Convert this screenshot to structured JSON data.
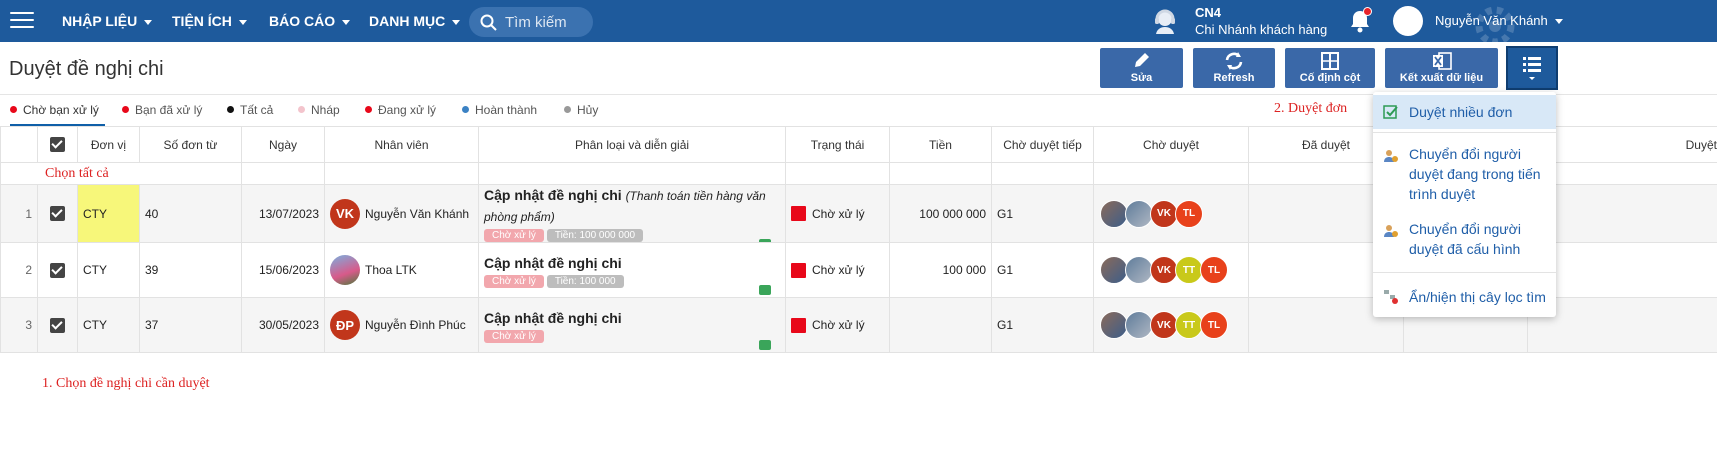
{
  "nav": {
    "items": [
      "NHẬP LIỆU",
      "TIỆN ÍCH",
      "BÁO CÁO",
      "DANH MỤC"
    ],
    "search_placeholder": "Tìm kiếm",
    "branch_code": "CN4",
    "branch_name": "Chi Nhánh khách hàng",
    "user_name": "Nguyễn Văn Khánh",
    "color": "#1e5a9c"
  },
  "page": {
    "title": "Duyệt đề nghị chi"
  },
  "toolbar": {
    "edit": "Sửa",
    "refresh": "Refresh",
    "fix_columns": "Cố định cột",
    "export": "Kết xuất dữ liệu"
  },
  "tabs": [
    {
      "label": "Chờ bạn xử lý",
      "color": "#e8081a"
    },
    {
      "label": "Bạn đã xử lý",
      "color": "#e8081a"
    },
    {
      "label": "Tất cả",
      "color": "#111111"
    },
    {
      "label": "Nháp",
      "color": "#f3c4cc"
    },
    {
      "label": "Đang xử lý",
      "color": "#e8081a"
    },
    {
      "label": "Hoàn thành",
      "color": "#3b82c4"
    },
    {
      "label": "Hủy",
      "color": "#999999"
    }
  ],
  "annotations": {
    "approve_hint": "2. Duyệt đơn",
    "select_all_hint": "Chọn tất cả",
    "select_rows_hint": "1. Chọn đề nghị chi cần duyệt"
  },
  "table": {
    "headers": [
      "Đơn vị",
      "Số đơn từ",
      "Ngày",
      "Nhân viên",
      "Phân loại và diễn giải",
      "Trạng thái",
      "Tiền",
      "Chờ duyệt tiếp",
      "Chờ duyệt",
      "Đã duyệt",
      "Duyệt"
    ],
    "rows": [
      {
        "num": "1",
        "unit": "CTY",
        "doc_no": "40",
        "date": "13/07/2023",
        "employee": "Nguyễn Văn Khánh",
        "employee_initials": "VK",
        "title": "Cập nhật đề nghị chi",
        "detail": "(Thanh toán tiền hàng văn phòng phẩm)",
        "tag_status": "Chờ xử lý",
        "tag_amount": "Tiền: 100 000 000",
        "status": "Chờ xử lý",
        "amount": "100 000 000",
        "next": "G1",
        "approvers": [
          "photo",
          "photo",
          "VK",
          "TL"
        ]
      },
      {
        "num": "2",
        "unit": "CTY",
        "doc_no": "39",
        "date": "15/06/2023",
        "employee": "Thoa LTK",
        "employee_initials": "",
        "title": "Cập nhật đề nghị chi",
        "detail": "",
        "tag_status": "Chờ xử lý",
        "tag_amount": "Tiền: 100 000",
        "status": "Chờ xử lý",
        "amount": "100 000",
        "next": "G1",
        "approvers": [
          "photo",
          "photo",
          "VK",
          "TT",
          "TL"
        ]
      },
      {
        "num": "3",
        "unit": "CTY",
        "doc_no": "37",
        "date": "30/05/2023",
        "employee": "Nguyễn Đình Phúc",
        "employee_initials": "ĐP",
        "title": "Cập nhật đề nghị chi",
        "detail": "",
        "tag_status": "Chờ xử lý",
        "tag_amount": "",
        "status": "Chờ xử lý",
        "amount": "",
        "next": "G1",
        "approvers": [
          "photo",
          "photo",
          "VK",
          "TT",
          "TL"
        ]
      }
    ]
  },
  "menu": {
    "items": [
      "Duyệt nhiều đơn",
      "Chuyển đổi người duyệt đang trong tiến trình duyệt",
      "Chuyển đổi người duyệt đã cấu hình",
      "Ẩn/hiện thị cây lọc tìm"
    ]
  }
}
